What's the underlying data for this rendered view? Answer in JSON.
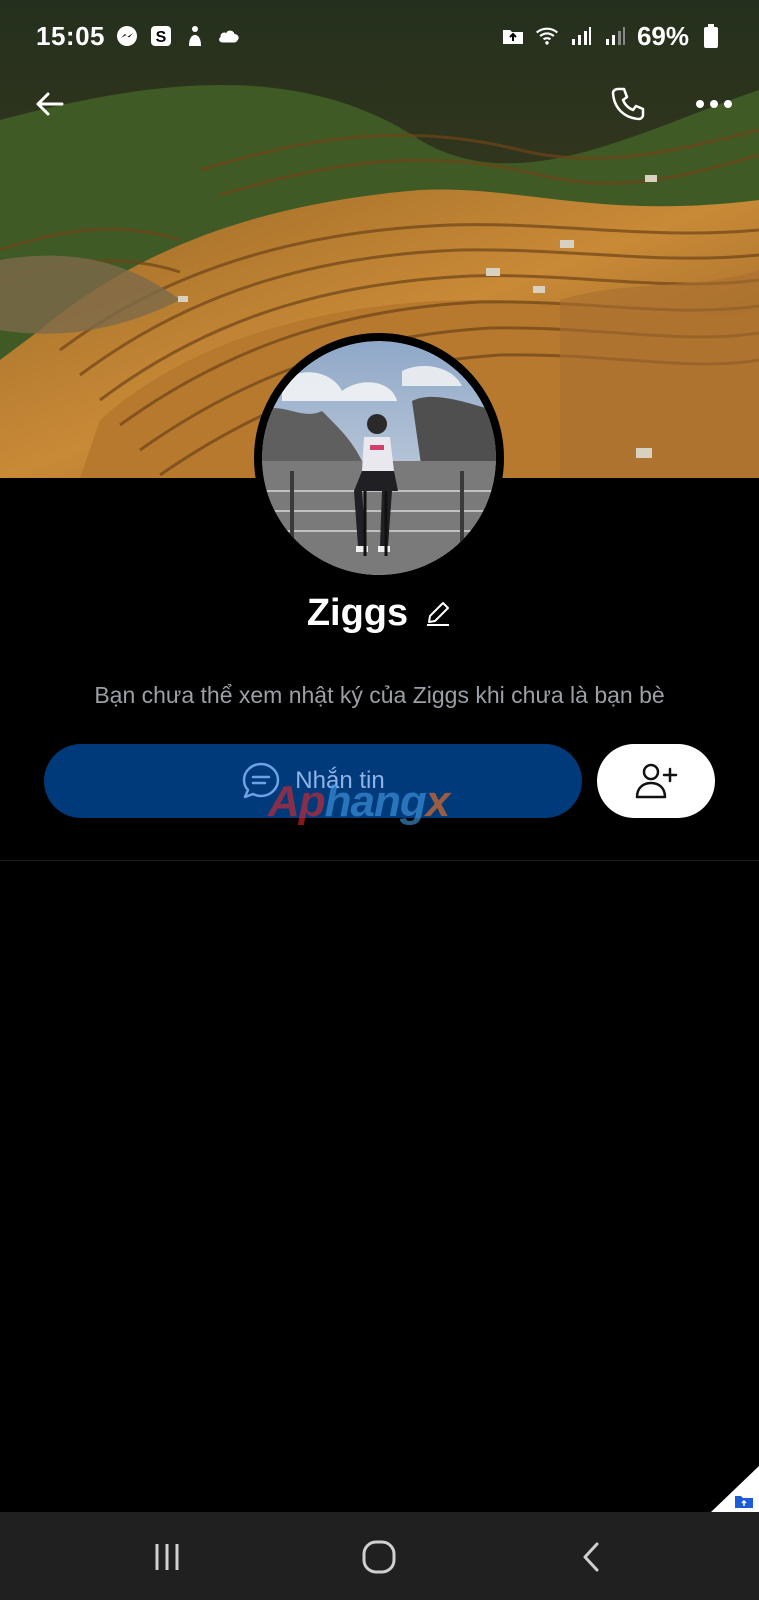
{
  "status_bar": {
    "time": "15:05",
    "notification_icons": [
      "messenger-icon",
      "s-app-icon",
      "gesture-icon",
      "cloud-icon"
    ],
    "right_icons": [
      "vpn-lock-icon",
      "wifi-icon",
      "signal-icon",
      "signal-icon"
    ],
    "battery_percent": "69%"
  },
  "nav": {
    "back_icon": "arrow-left-icon",
    "call_icon": "phone-icon",
    "more_icon": "more-horizontal-icon"
  },
  "profile": {
    "name": "Ziggs",
    "edit_icon": "pencil-icon",
    "info": "Bạn chưa thể xem nhật ký của Ziggs khi chưa là bạn bè"
  },
  "actions": {
    "message_label": "Nhắn tin",
    "message_icon": "chat-bubble-icon",
    "add_friend_icon": "user-plus-icon",
    "message_button_color": "#003a7a",
    "add_button_color": "#ffffff"
  },
  "watermark": {
    "part1": "Ap",
    "part2": "hang",
    "part3": "x"
  },
  "bottom_nav": {
    "items": [
      "recents-icon",
      "home-icon",
      "back-icon"
    ]
  }
}
